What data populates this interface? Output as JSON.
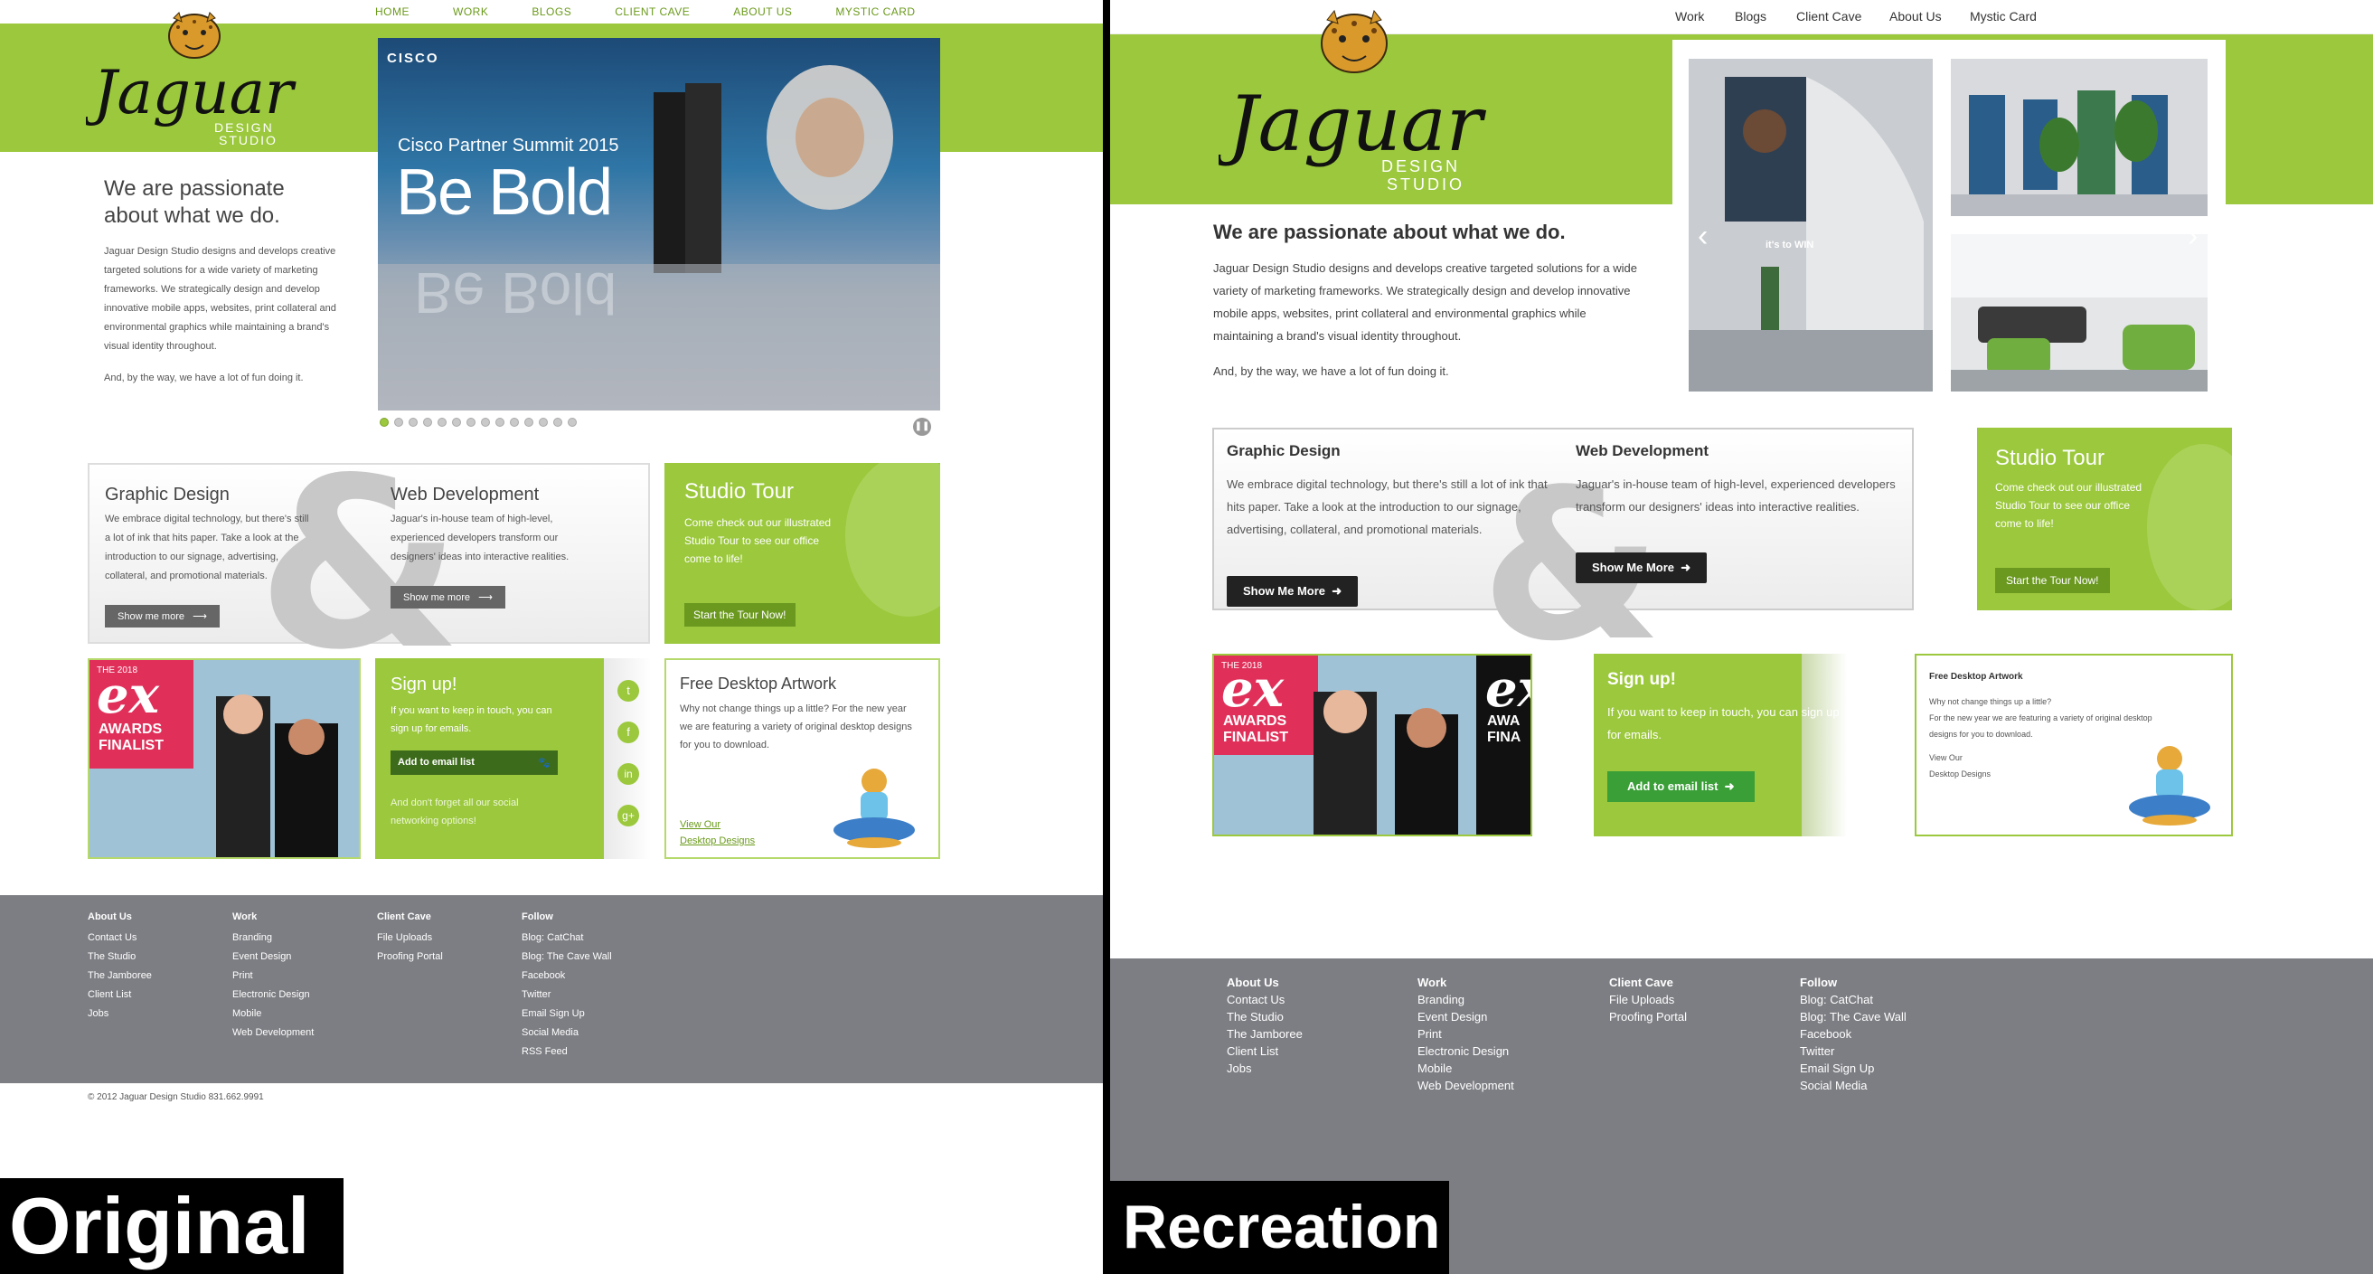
{
  "original": {
    "label": "Original",
    "nav": [
      "HOME",
      "WORK",
      "BLOGS",
      "CLIENT CAVE",
      "ABOUT US",
      "MYSTIC CARD"
    ],
    "logo": {
      "word": "Jaguar",
      "sub1": "DESIGN",
      "sub2": "STUDIO"
    },
    "hero": {
      "brand": "CISCO",
      "event": "Cisco Partner Summit 2015",
      "headline": "Be Bold"
    },
    "slides": 14,
    "intro": {
      "title": "We are passionate about what we do.",
      "body": "Jaguar Design Studio designs and develops creative targeted solutions for a wide variety of marketing frameworks. We strategically design and develop innovative mobile apps, websites, print collateral and environmental graphics while maintaining a brand's visual identity throughout.",
      "closing": "And, by the way, we have a lot of fun doing it."
    },
    "graphic": {
      "title": "Graphic Design",
      "body": "We embrace digital technology, but there's still a lot of ink that hits paper. Take a look at the introduction to our signage, advertising, collateral, and promotional materials.",
      "button": "Show me more"
    },
    "web": {
      "title": "Web Development",
      "body": "Jaguar's in-house team of high-level, experienced developers transform our designers' ideas into interactive realities.",
      "button": "Show me more"
    },
    "ampersand": "&",
    "tour": {
      "title": "Studio Tour",
      "body": "Come check out our illustrated Studio Tour to see our office come to life!",
      "button": "Start the Tour Now!"
    },
    "awards": {
      "year": "THE 2018",
      "mark": "ex",
      "line1": "AWARDS",
      "line2": "FINALIST"
    },
    "signup": {
      "title": "Sign up!",
      "body": "If you want to keep in touch, you can sign up for emails.",
      "button": "Add to email list",
      "social": "And don't forget all our social networking options!"
    },
    "desktop": {
      "title": "Free Desktop Artwork",
      "body": "Why not change things up a little? For the new year we are featuring a variety of original desktop designs for you to download.",
      "link1": "View Our",
      "link2": "Desktop Designs"
    },
    "footer": [
      {
        "head": "About Us",
        "items": [
          "Contact Us",
          "The Studio",
          "The Jamboree",
          "Client List",
          "Jobs"
        ]
      },
      {
        "head": "Work",
        "items": [
          "Branding",
          "Event Design",
          "Print",
          "Electronic Design",
          "Mobile",
          "Web Development"
        ]
      },
      {
        "head": "Client Cave",
        "items": [
          "File Uploads",
          "Proofing Portal"
        ]
      },
      {
        "head": "Follow",
        "items": [
          "Blog: CatChat",
          "Blog: The Cave Wall",
          "Facebook",
          "Twitter",
          "Email Sign Up",
          "Social Media",
          "RSS Feed"
        ]
      }
    ],
    "copyright": "© 2012 Jaguar Design Studio 831.662.9991"
  },
  "recreation": {
    "label": "Recreation",
    "nav": [
      "Work",
      "Blogs",
      "Client Cave",
      "About Us",
      "Mystic Card"
    ],
    "logo": {
      "word": "Jaguar",
      "sub1": "DESIGN",
      "sub2": "STUDIO"
    },
    "intro": {
      "title": "We are passionate about what we do.",
      "body": "Jaguar Design Studio designs and develops creative targeted solutions for a wide variety of marketing frameworks. We strategically design and develop innovative mobile apps, websites, print collateral and environmental graphics while maintaining a brand's visual identity throughout.",
      "closing": "And, by the way, we have a lot of fun doing it."
    },
    "gallery_caption": "it's to WIN",
    "graphic": {
      "title": "Graphic Design",
      "body": "We embrace digital technology, but there's still a lot of ink that hits paper. Take a look at the introduction to our signage, advertising, collateral, and promotional materials.",
      "button": "Show Me More"
    },
    "web": {
      "title": "Web Development",
      "body": "Jaguar's in-house team of high-level, experienced developers transform our designers' ideas into interactive realities.",
      "button": "Show Me More"
    },
    "ampersand": "&",
    "tour": {
      "title": "Studio Tour",
      "body": "Come check out our illustrated Studio Tour to see our office come to life!",
      "button": "Start the Tour Now!"
    },
    "awards": {
      "year": "THE 2018",
      "mark": "ex",
      "line1": "AWARDS",
      "line2": "FINALIST",
      "line1b": "AWA",
      "line2b": "FINA"
    },
    "signup": {
      "title": "Sign up!",
      "body": "If you want to keep in touch, you can sign up for emails.",
      "button": "Add to email list"
    },
    "desktop": {
      "title": "Free Desktop Artwork",
      "body1": "Why not change things up a little?",
      "body2": "For the new year we are featuring a variety of original desktop designs for you to download.",
      "link1": "View Our",
      "link2": "Desktop Designs"
    },
    "footer": [
      {
        "head": "About Us",
        "items": [
          "Contact Us",
          "The Studio",
          "The Jamboree",
          "Client List",
          "Jobs"
        ]
      },
      {
        "head": "Work",
        "items": [
          "Branding",
          "Event Design",
          "Print",
          "Electronic Design",
          "Mobile",
          "Web Development"
        ]
      },
      {
        "head": "Client Cave",
        "items": [
          "File Uploads",
          "Proofing Portal"
        ]
      },
      {
        "head": "Follow",
        "items": [
          "Blog: CatChat",
          "Blog: The Cave Wall",
          "Facebook",
          "Twitter",
          "Email Sign Up",
          "Social Media"
        ]
      }
    ]
  },
  "colors": {
    "brand_green": "#9bc83c",
    "footer_gray": "#7d7e83",
    "dark_button": "#222222"
  },
  "icons": [
    "jaguar-head-icon",
    "twitter-icon",
    "facebook-icon",
    "linkedin-icon",
    "google-plus-icon",
    "pause-icon",
    "arrow-right-icon",
    "chevron-left-icon",
    "chevron-right-icon",
    "meditating-cat-icon",
    "leaf-icon"
  ]
}
